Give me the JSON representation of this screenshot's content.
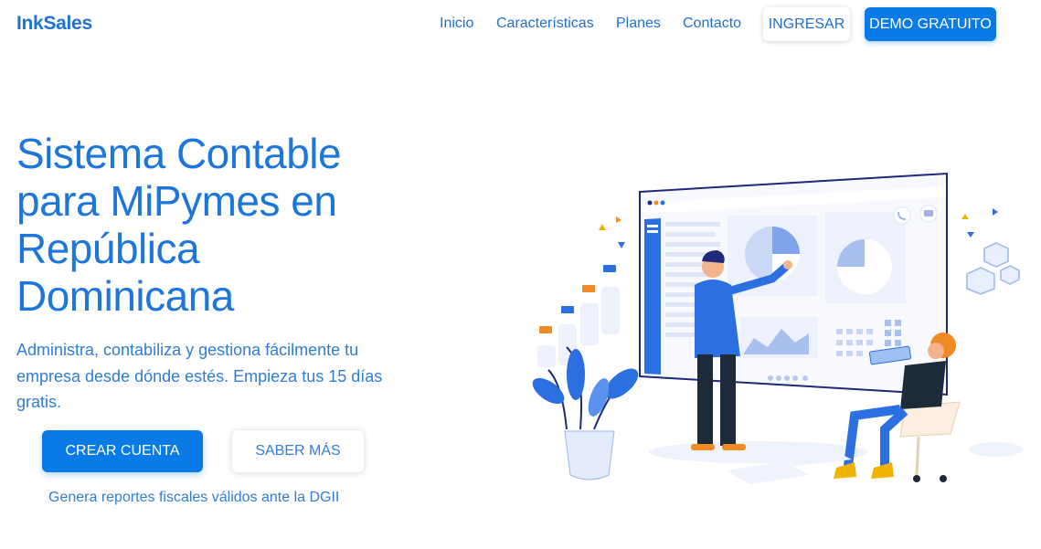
{
  "nav": {
    "logo": "InkSales",
    "links": [
      "Inicio",
      "Características",
      "Planes",
      "Contacto"
    ],
    "login_label": "INGRESAR",
    "demo_label": "DEMO GRATUITO"
  },
  "hero": {
    "title": "Sistema Contable para MiPymes en República Dominicana",
    "subtitle": "Administra, contabiliza y gestiona fácilmente tu empresa desde dónde estés. Empieza tus 15 días gratis.",
    "primary_cta": "CREAR CUENTA",
    "secondary_cta": "SABER MÁS",
    "footnote": "Genera reportes fiscales válidos ante la DGII"
  },
  "colors": {
    "brand": "#0a7ae6",
    "text_blue": "#1d76d9",
    "illustration_blue": "#2b6fe0",
    "accent_orange": "#f08a24"
  },
  "icons": [
    "phone-icon",
    "chat-icon"
  ]
}
